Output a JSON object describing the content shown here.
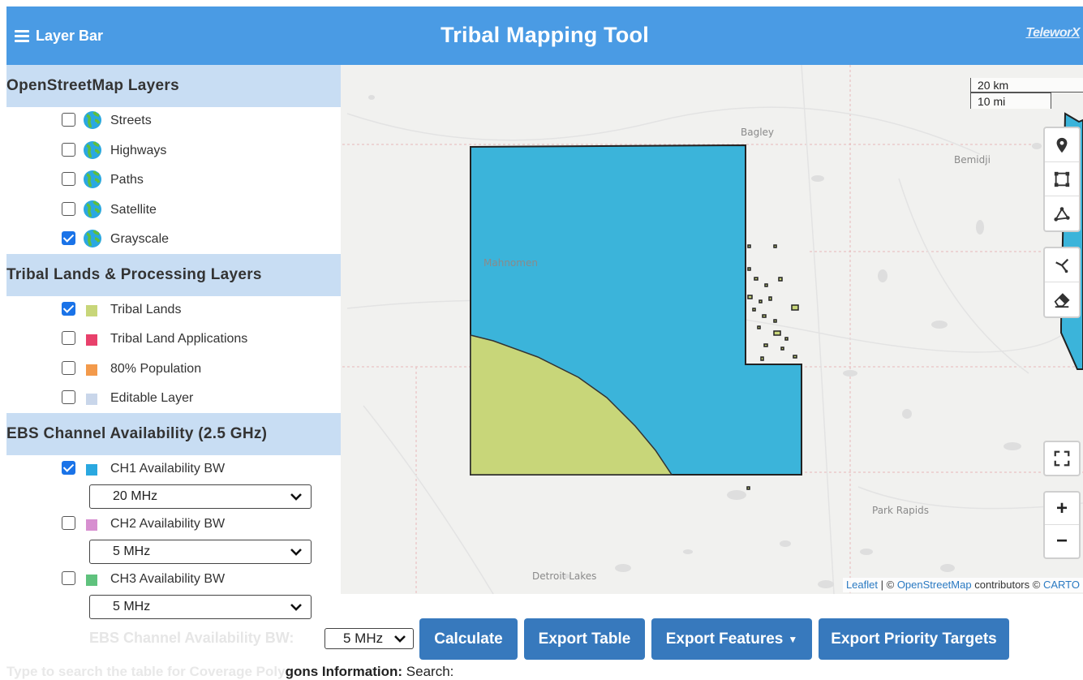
{
  "header": {
    "layer_bar_label": "Layer Bar",
    "title": "Tribal Mapping Tool",
    "brand": "TeleworX"
  },
  "sidebar": {
    "osm": {
      "title": "OpenStreetMap Layers",
      "layers": [
        {
          "label": "Streets",
          "checked": false
        },
        {
          "label": "Highways",
          "checked": false
        },
        {
          "label": "Paths",
          "checked": false
        },
        {
          "label": "Satellite",
          "checked": false
        },
        {
          "label": "Grayscale",
          "checked": true
        }
      ]
    },
    "tribal": {
      "title": "Tribal Lands & Processing Layers",
      "layers": [
        {
          "label": "Tribal Lands",
          "checked": true,
          "color": "#c8d679"
        },
        {
          "label": "Tribal Land Applications",
          "checked": false,
          "color": "#e8416b"
        },
        {
          "label": "80% Population",
          "checked": false,
          "color": "#f39a4b"
        },
        {
          "label": "Editable Layer",
          "checked": false,
          "color": "#c9d6ea"
        }
      ]
    },
    "ebs": {
      "title": "EBS Channel Availability (2.5 GHz)",
      "channels": [
        {
          "label": "CH1 Availability BW",
          "checked": true,
          "color": "#2aa8e0",
          "selected": "20 MHz"
        },
        {
          "label": "CH2 Availability BW",
          "checked": false,
          "color": "#d78fd0",
          "selected": "5 MHz"
        },
        {
          "label": "CH3 Availability BW",
          "checked": false,
          "color": "#5fc27d",
          "selected": "5 MHz"
        }
      ]
    }
  },
  "map": {
    "places": [
      "Bagley",
      "Bemidji",
      "Mahnomen",
      "Park Rapids",
      "Detroit Lakes"
    ],
    "scale": {
      "km": "20 km",
      "mi": "10 mi"
    },
    "attribution": {
      "leaflet": "Leaflet",
      "sep": "| ©",
      "osm": "OpenStreetMap",
      "contrib": "contributors ©",
      "carto": "CARTO"
    },
    "colors": {
      "coverage": "#3bb4da",
      "tribal": "#c8d679"
    }
  },
  "bottom": {
    "bw_label": "EBS Channel Availability BW:",
    "bw_value": "5 MHz",
    "buttons": {
      "calculate": "Calculate",
      "export_table": "Export Table",
      "export_features": "Export Features",
      "export_priority": "Export Priority Targets"
    },
    "search_faded": "Type to search the table for Coverage Poly",
    "search_strong": "gons Information:",
    "search_label": "Search:"
  }
}
